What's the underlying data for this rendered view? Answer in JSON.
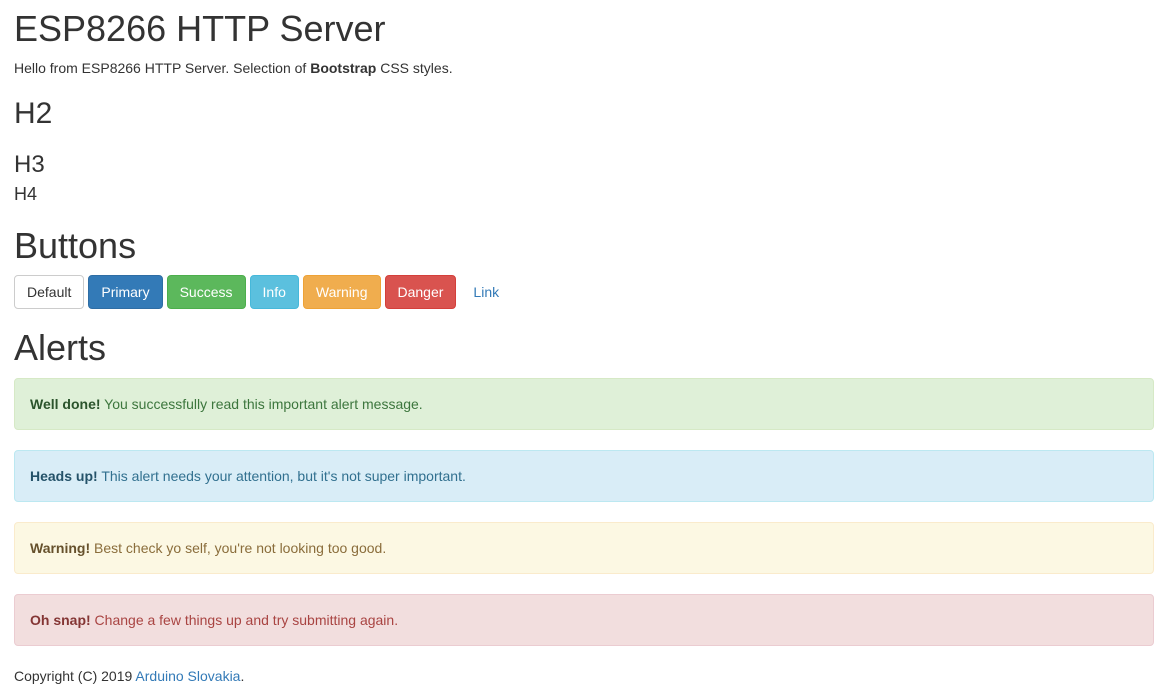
{
  "header": {
    "title": "ESP8266 HTTP Server",
    "intro_prefix": "Hello from ESP8266 HTTP Server. Selection of ",
    "intro_bold": "Bootstrap",
    "intro_suffix": " CSS styles."
  },
  "headings": {
    "h2": "H2",
    "h3": "H3",
    "h4": "H4"
  },
  "buttons": {
    "title": "Buttons",
    "items": [
      {
        "label": "Default"
      },
      {
        "label": "Primary"
      },
      {
        "label": "Success"
      },
      {
        "label": "Info"
      },
      {
        "label": "Warning"
      },
      {
        "label": "Danger"
      },
      {
        "label": "Link"
      }
    ]
  },
  "alerts": {
    "title": "Alerts",
    "items": [
      {
        "strong": "Well done!",
        "text": " You successfully read this important alert message."
      },
      {
        "strong": "Heads up!",
        "text": " This alert needs your attention, but it's not super important."
      },
      {
        "strong": "Warning!",
        "text": " Best check yo self, you're not looking too good."
      },
      {
        "strong": "Oh snap!",
        "text": " Change a few things up and try submitting again."
      }
    ]
  },
  "footer": {
    "prefix": "Copyright (C) 2019 ",
    "link": "Arduino Slovakia",
    "suffix": "."
  },
  "colors": {
    "primary": "#337ab7",
    "success": "#5cb85c",
    "info": "#5bc0de",
    "warning": "#f0ad4e",
    "danger": "#d9534f"
  }
}
